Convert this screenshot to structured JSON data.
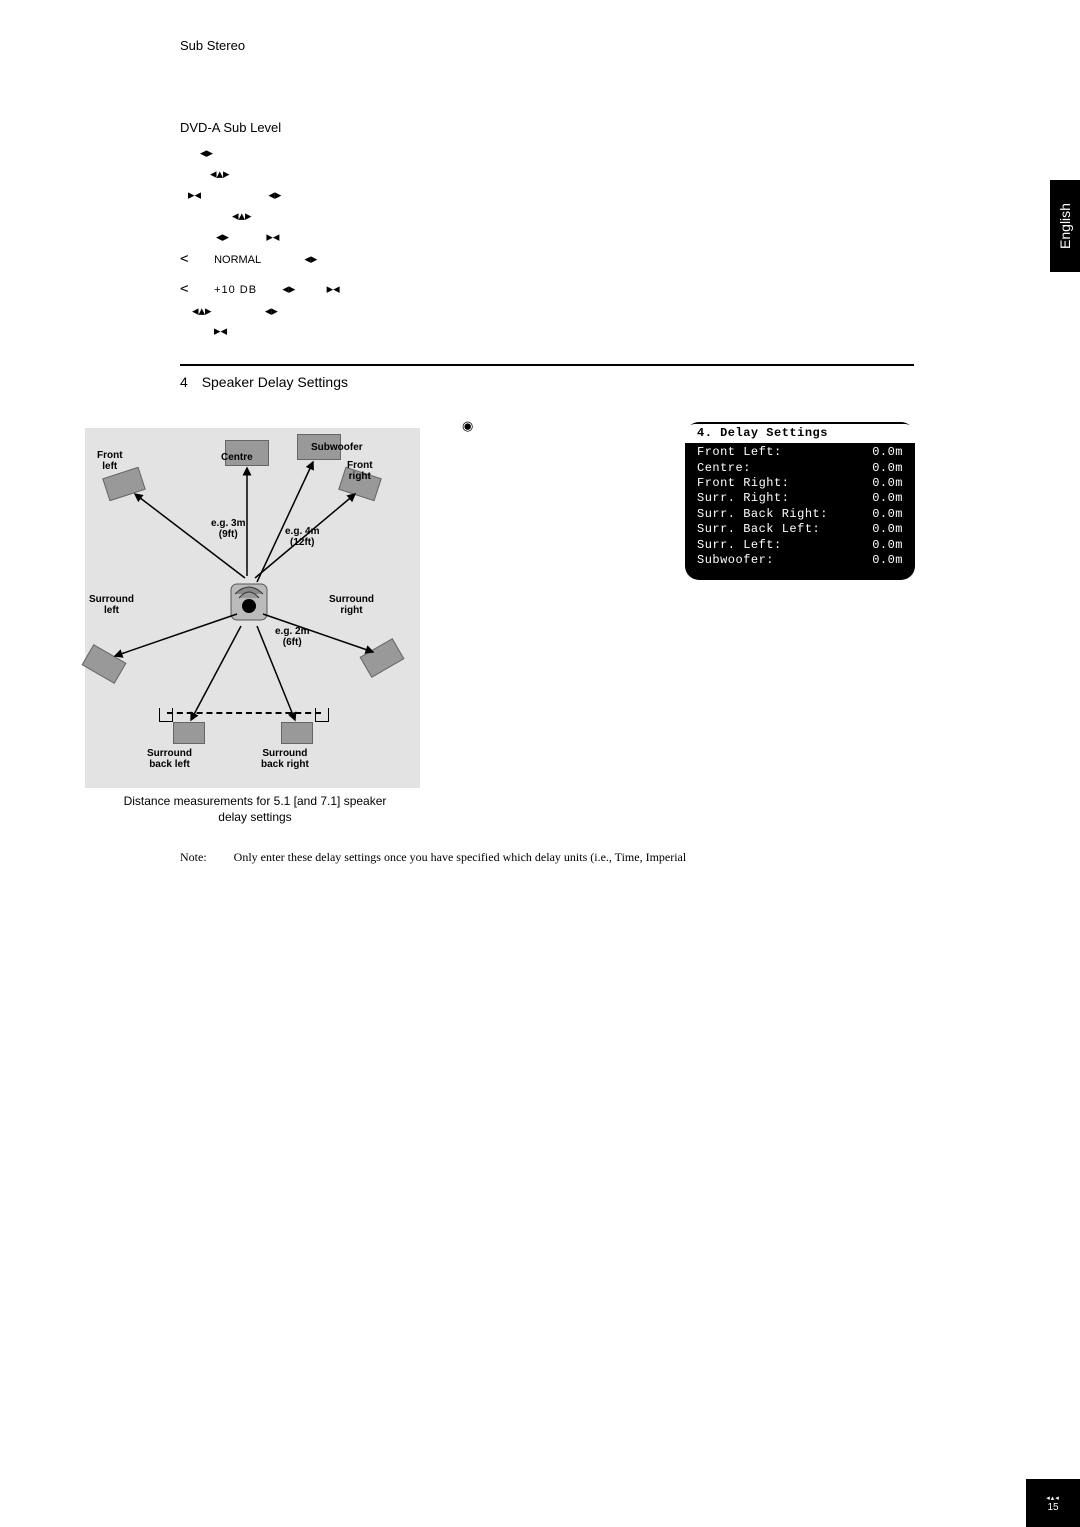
{
  "header": {
    "sub_stereo": "Sub Stereo"
  },
  "sublevel": {
    "title": "DVD-A Sub Level",
    "normal": "NORMAL",
    "plus10": "+10 DB"
  },
  "section4": {
    "num": "4",
    "title": "Speaker Delay Settings"
  },
  "lang": "English",
  "diagram": {
    "front_left": "Front\nleft",
    "centre": "Centre",
    "subwoofer": "Subwoofer",
    "front_right": "Front\nright",
    "surround_left": "Surround\nleft",
    "surround_right": "Surround\nright",
    "surround_back_left": "Surround\nback left",
    "surround_back_right": "Surround\nback right",
    "eg3m": "e.g. 3m\n(9ft)",
    "eg4m": "e.g. 4m\n(12ft)",
    "eg2m": "e.g. 2m\n(6ft)"
  },
  "caption": "Distance measurements for 5.1 [and 7.1] speaker delay settings",
  "note": {
    "label": "Note:",
    "body": "Only enter these delay settings once you have specified which delay units (i.e., Time, Imperial"
  },
  "osd": {
    "title": " 4. Delay Settings",
    "rows": [
      {
        "k": "Front Left:",
        "v": "0.0m"
      },
      {
        "k": "Centre:",
        "v": "0.0m"
      },
      {
        "k": "Front Right:",
        "v": "0.0m"
      },
      {
        "k": "Surr. Right:",
        "v": "0.0m"
      },
      {
        "k": "Surr. Back Right:",
        "v": "0.0m"
      },
      {
        "k": "Surr. Back Left:",
        "v": "0.0m"
      },
      {
        "k": "Surr. Left:",
        "v": "0.0m"
      },
      {
        "k": "Subwoofer:",
        "v": "0.0m"
      }
    ]
  },
  "page_number": "15"
}
